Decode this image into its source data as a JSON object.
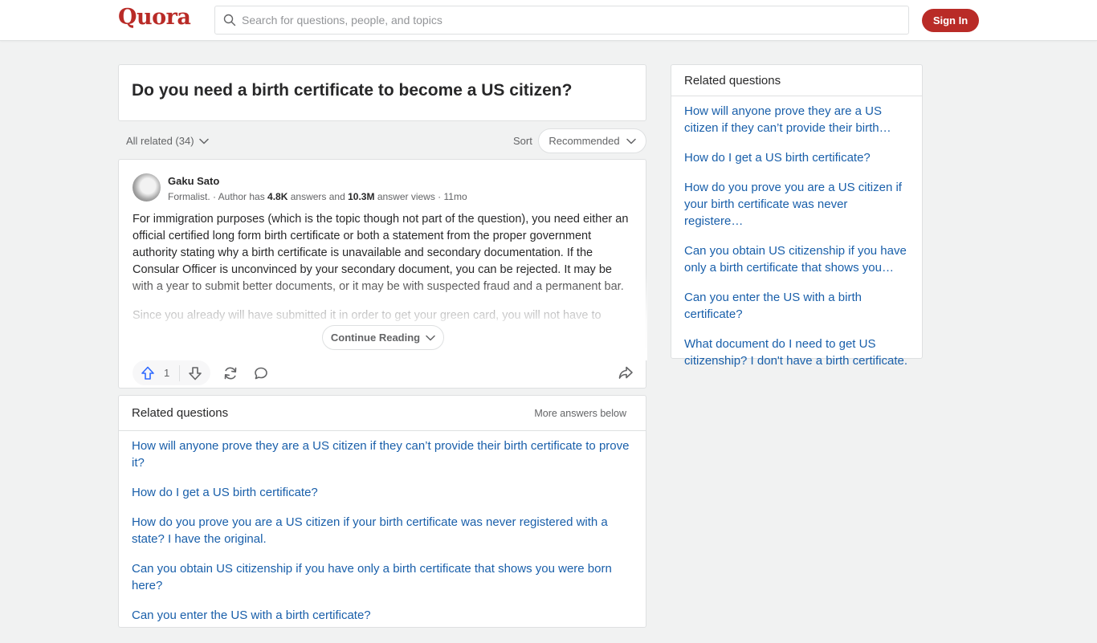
{
  "header": {
    "logo": "Quora",
    "search_placeholder": "Search for questions, people, and topics",
    "search_value": "",
    "signin_label": "Sign In",
    "brand_color": "#b92b27"
  },
  "question": {
    "title": "Do you need a birth certificate to become a US citizen?"
  },
  "sortbar": {
    "all_related": "All related (34)",
    "sort_label": "Sort",
    "sort_value": "Recommended"
  },
  "answer": {
    "author_name": "Gaku Sato",
    "credential": "Formalist. · Author has ",
    "answers_count": "4.8K",
    "answers_text": " answers and ",
    "views_count": "10.3M",
    "views_text": " answer views · 11mo",
    "paragraphs": [
      "For immigration purposes (which is the topic though not part of the question), you need either an official certified long form birth certificate or both a statement from the proper government authority stating why a birth certificate is unavailable and secondary documentation. If the Consular Officer is unconvinced by your secondary document, you can be rejected. It may be with a year to submit better documents, or it may be with suspected fraud and a permanent bar.",
      "Since you already will have submitted it in order to get your green card, you will not have to resubmit it for naturalization."
    ],
    "continue_label": "Continue Reading",
    "upvotes": "1"
  },
  "related_inline": {
    "heading": "Related questions",
    "more_label": "More answers below",
    "items": [
      "How will anyone prove they are a US citizen if they can’t provide their birth certificate to prove it?",
      "How do I get a US birth certificate?",
      "How do you prove you are a US citizen if your birth certificate was never registered with a state? I have the original.",
      "Can you obtain US citizenship if you have only a birth certificate that shows you were born here?",
      "Can you enter the US with a birth certificate?"
    ]
  },
  "sidebar": {
    "heading": "Related questions",
    "items": [
      "How will anyone prove they are a US citizen if they can’t provide their birth…",
      "How do I get a US birth certificate?",
      "How do you prove you are a US citizen if your birth certificate was never registere…",
      "Can you obtain US citizenship if you have only a birth certificate that shows you…",
      "Can you enter the US with a birth certificate?",
      "What document do I need to get US citizenship? I don't have a birth certificate."
    ]
  }
}
